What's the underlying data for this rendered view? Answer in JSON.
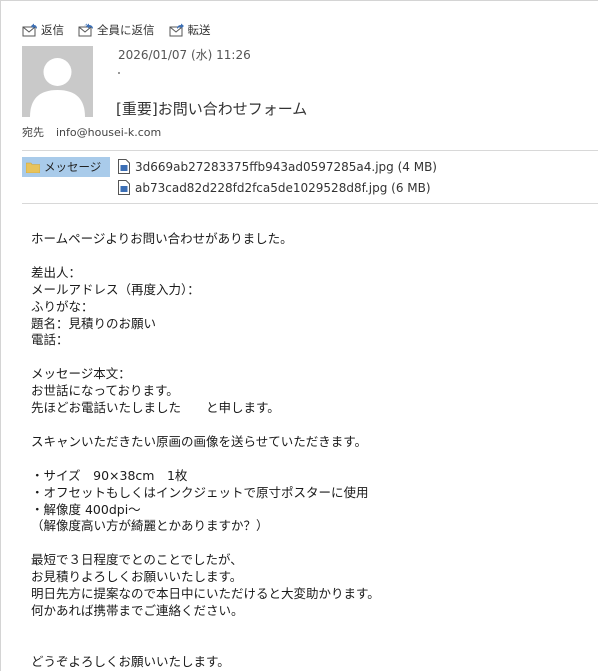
{
  "toolbar": {
    "reply_label": "返信",
    "reply_all_label": "全員に返信",
    "forward_label": "転送"
  },
  "header": {
    "date": "2026/01/07 (水) 11:26",
    "subject": "[重要]お問い合わせフォーム",
    "to_label": "宛先",
    "to_address": "info@housei-k.com"
  },
  "attachments_tab": {
    "label": "メッセージ"
  },
  "attachments": [
    {
      "name": "3d669ab27283375ffb943ad0597285a4.jpg (4 MB)"
    },
    {
      "name": "ab73cad82d228fd2fca5de1029528d8f.jpg (6 MB)"
    }
  ],
  "body": {
    "text": "ホームページよりお問い合わせがありました。\n\n差出人：\nメールアドレス（再度入力）：\nふりがな：\n題名：見積りのお願い\n電話：\n\nメッセージ本文：\nお世話になっております。\n先ほどお電話いたしました　　と申します。\n\nスキャンいただきたい原画の画像を送らせていただきます。\n\n・サイズ　90×38cm　1枚\n・オフセットもしくはインクジェットで原寸ポスターに使用\n・解像度 400dpi～\n（解像度高い方が綺麗とかありますか？）\n\n最短で３日程度でとのことでしたが、\nお見積りよろしくお願いいたします。\n明日先方に提案なので本日中にいただけると大変助かります。\n何かあれば携帯までご連絡ください。\n\n\nどうぞよろしくお願いいたします。"
  },
  "colors": {
    "tab_background": "#a9cbea",
    "avatar_background": "#c9c9c9",
    "icon_blue": "#3c6fb5"
  }
}
